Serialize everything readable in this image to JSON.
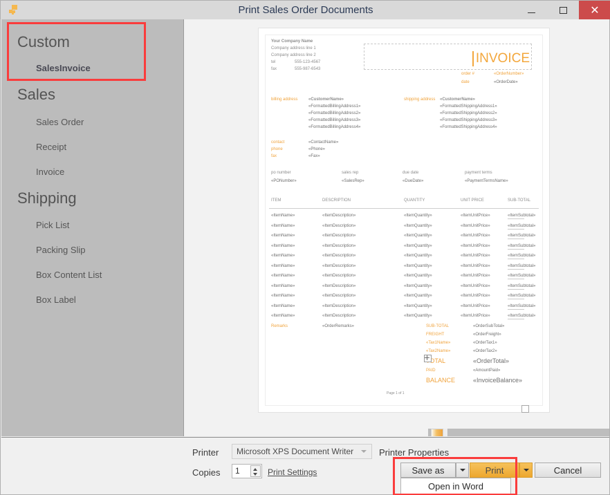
{
  "window": {
    "title": "Print Sales Order Documents",
    "app_icon": "puzzle-piece-icon",
    "minimize": "—",
    "maximize": "☐",
    "close": "✕"
  },
  "sidebar": {
    "groups": [
      {
        "title": "Custom",
        "items": [
          {
            "label": "SalesInvoice",
            "selected": true
          }
        ]
      },
      {
        "title": "Sales",
        "items": [
          {
            "label": "Sales Order",
            "selected": false
          },
          {
            "label": "Receipt",
            "selected": false
          },
          {
            "label": "Invoice",
            "selected": false
          }
        ]
      },
      {
        "title": "Shipping",
        "items": [
          {
            "label": "Pick List",
            "selected": false
          },
          {
            "label": "Packing Slip",
            "selected": false
          },
          {
            "label": "Box Content List",
            "selected": false
          },
          {
            "label": "Box Label",
            "selected": false
          }
        ]
      }
    ]
  },
  "document": {
    "company": {
      "name": "Your Company Name",
      "address1": "Company address line 1",
      "address2": "Company address line 2",
      "tel_label": "tel",
      "tel_value": "555-123-4567",
      "fax_label": "fax",
      "fax_value": "555-987-6543"
    },
    "invoice_word": "INVOICE",
    "order_number_label": "order #",
    "order_number_value": "«OrderNumber»",
    "date_label": "date",
    "date_value": "«OrderDate»",
    "billing": {
      "label": "billing address",
      "name": "«CustomerName»",
      "line1": "«FormattedBillingAddress1»",
      "line2": "«FormattedBillingAddress2»",
      "line3": "«FormattedBillingAddress3»",
      "line4": "«FormattedBillingAddress4»"
    },
    "shipping": {
      "label": "shipping address",
      "name": "«CustomerName»",
      "line1": "«FormattedShippingAddress1»",
      "line2": "«FormattedShippingAddress2»",
      "line3": "«FormattedShippingAddress3»",
      "line4": "«FormattedShippingAddress4»"
    },
    "contact": {
      "contact_label": "contact",
      "contact_value": "«ContactName»",
      "phone_label": "phone",
      "phone_value": "«Phone»",
      "fax_label": "fax",
      "fax_value": "«Fax»"
    },
    "meta": {
      "po_label": "po number",
      "po_value": "«PONumber»",
      "rep_label": "sales rep",
      "rep_value": "«SalesRep»",
      "due_label": "due date",
      "due_value": "«DueDate»",
      "terms_label": "payment terms",
      "terms_value": "«PaymentTermsName»"
    },
    "table": {
      "headers": [
        "ITEM",
        "DESCRIPTION",
        "QUANTITY",
        "UNIT PRICE",
        "SUB-TOTAL"
      ],
      "row_count": 11,
      "row": {
        "item": "«ItemName»",
        "description": "«ItemDescription»",
        "quantity": "«ItemQuantity»",
        "unit_price": "«ItemUnitPrice»",
        "sub_total": "«ItemSubtotal»"
      }
    },
    "remarks_label": "Remarks",
    "remarks_value": "«OrderRemarks»",
    "totals": [
      {
        "label": "SUB-TOTAL",
        "value": "«OrderSubTotal»",
        "emphasis": "small"
      },
      {
        "label": "FREIGHT",
        "value": "«OrderFreight»",
        "emphasis": "small"
      },
      {
        "label": "«Tax1Name»",
        "value": "«OrderTax1»",
        "emphasis": "small"
      },
      {
        "label": "«Tax2Name»",
        "value": "«OrderTax2»",
        "emphasis": "small"
      },
      {
        "label": "TOTAL",
        "value": "«OrderTotal»",
        "emphasis": "large"
      },
      {
        "label": "PAID",
        "value": "«AmountPaid»",
        "emphasis": "small"
      },
      {
        "label": "BALANCE",
        "value": "«InvoiceBalance»",
        "emphasis": "large"
      }
    ],
    "footer_page": "Page 1 of 1"
  },
  "footer": {
    "printer_label": "Printer",
    "printer_value": "Microsoft XPS Document Writer",
    "printer_properties": "Printer Properties",
    "copies_label": "Copies",
    "copies_value": "1",
    "print_settings": "Print Settings",
    "buttons": {
      "save_as": "Save as",
      "print": "Print",
      "cancel": "Cancel",
      "open_in_word": "Open in Word"
    }
  },
  "annotations": {
    "highlight_color": "#fa3c3c",
    "boxes": [
      "custom-salesinvoice-region",
      "save-as-print-region"
    ]
  },
  "colors": {
    "accent_orange": "#eda72f",
    "title_bar": "#d9d9d9",
    "sidebar": "#bcbcbc",
    "close_red": "#cc4b4b"
  }
}
